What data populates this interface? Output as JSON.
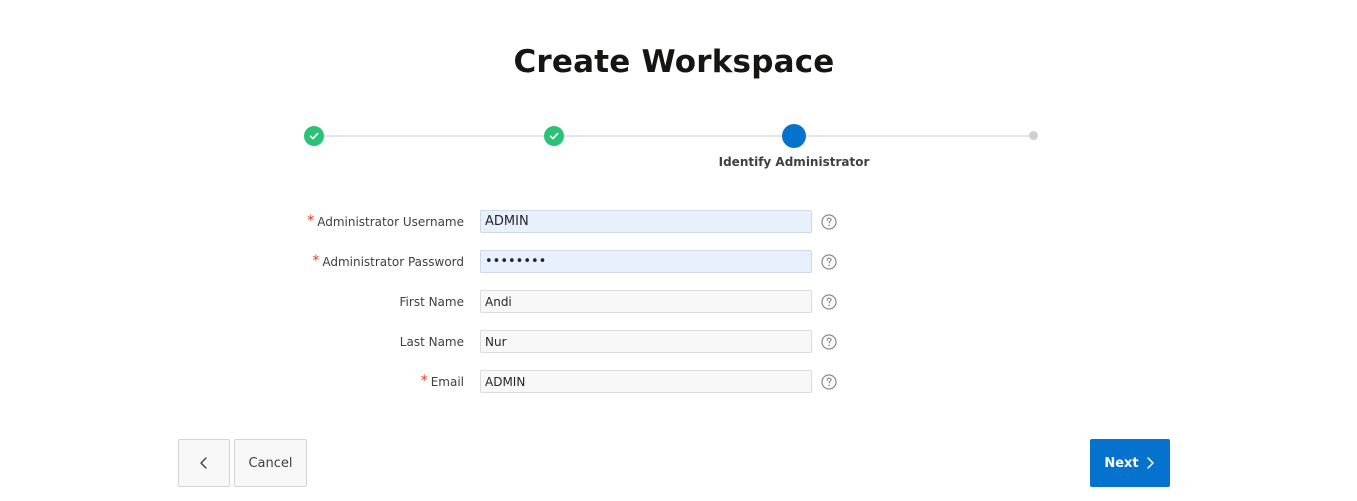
{
  "page": {
    "title": "Create Workspace"
  },
  "wizard": {
    "current_step_label": "Identify Administrator",
    "colors": {
      "done": "#2bc278",
      "current": "#0572ce",
      "future": "#cfcfcf"
    }
  },
  "form": {
    "username": {
      "label": "Administrator Username",
      "value": "ADMIN",
      "required": "*"
    },
    "password": {
      "label": "Administrator Password",
      "value": "••••••••",
      "required": "*"
    },
    "first_name": {
      "label": "First Name",
      "value": "Andi"
    },
    "last_name": {
      "label": "Last Name",
      "value": "Nur"
    },
    "email": {
      "label": "Email",
      "value": "ADMIN",
      "required": "*"
    }
  },
  "buttons": {
    "cancel_label": "Cancel",
    "next_label": "Next",
    "accent": "#0572ce"
  },
  "icons": {
    "check": "check-icon",
    "help": "help-icon",
    "prev": "chevron-left-icon",
    "next": "chevron-right-icon"
  }
}
